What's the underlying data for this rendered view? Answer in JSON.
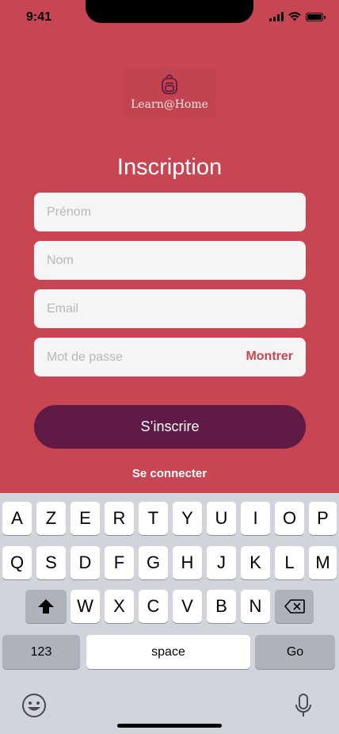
{
  "status": {
    "time": "9:41"
  },
  "logo": {
    "text": "Learn@Home"
  },
  "form": {
    "title": "Inscription",
    "first_name_placeholder": "Prénom",
    "last_name_placeholder": "Nom",
    "email_placeholder": "Email",
    "password_placeholder": "Mot de passe",
    "show_label": "Montrer",
    "submit_label": "S’inscrire",
    "login_link": "Se connecter"
  },
  "keyboard": {
    "row1": [
      "A",
      "Z",
      "E",
      "R",
      "T",
      "Y",
      "U",
      "I",
      "O",
      "P"
    ],
    "row2": [
      "Q",
      "S",
      "D",
      "F",
      "G",
      "H",
      "J",
      "K",
      "L",
      "M"
    ],
    "row3": [
      "W",
      "X",
      "C",
      "V",
      "B",
      "N"
    ],
    "numbers_label": "123",
    "space_label": "space",
    "go_label": "Go"
  },
  "colors": {
    "background": "#c84653",
    "primary_button": "#5f1a45",
    "accent_text": "#c94553",
    "field_bg": "#f5f5f5"
  }
}
